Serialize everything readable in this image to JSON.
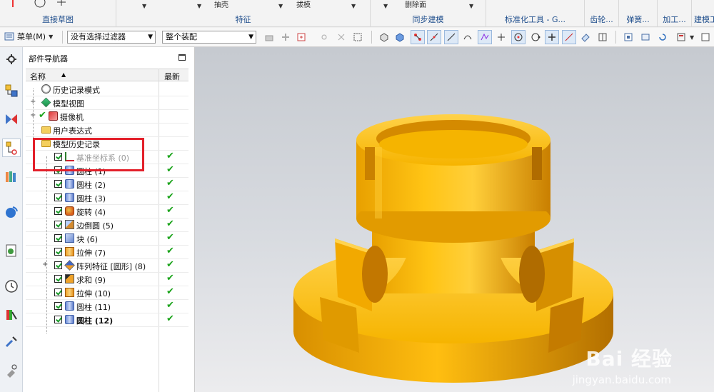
{
  "ribbon": {
    "groups": [
      {
        "label": "直接草图"
      },
      {
        "label": "特征"
      },
      {
        "label": "同步建模"
      },
      {
        "label": "标准化工具 - G..."
      },
      {
        "label": "齿轮..."
      },
      {
        "label": "弹簧..."
      },
      {
        "label": "加工..."
      },
      {
        "label": "建模工"
      }
    ],
    "partial_items": [
      "抽壳",
      "拔模",
      "删除面"
    ]
  },
  "toolbar": {
    "menu_label": "菜单(M)",
    "selection_filter": "没有选择过滤器",
    "assembly_scope": "整个装配"
  },
  "navigator": {
    "title": "部件导航器",
    "columns": {
      "name": "名称",
      "latest": "最新"
    },
    "rows": [
      {
        "label": "历史记录模式",
        "icon": "history-clock-icon",
        "level": 0,
        "checkbox": false,
        "latest": false,
        "expander": ""
      },
      {
        "label": "模型视图",
        "icon": "model-views-icon",
        "level": 0,
        "checkbox": false,
        "latest": false,
        "expander": "+"
      },
      {
        "label": "摄像机",
        "icon": "camera-icon",
        "level": 0,
        "checkbox": false,
        "latest": false,
        "expander": "+",
        "green_tick": true
      },
      {
        "label": "用户表达式",
        "icon": "folder-icon",
        "level": 0,
        "checkbox": false,
        "latest": false,
        "expander": ""
      },
      {
        "label": "模型历史记录",
        "icon": "folder-open-icon",
        "level": 0,
        "checkbox": false,
        "latest": false,
        "expander": "-"
      },
      {
        "label": "基准坐标系 (0)",
        "icon": "datum-csys-icon",
        "level": 1,
        "checkbox": true,
        "latest": true,
        "muted": true
      },
      {
        "label": "圆柱 (1)",
        "icon": "cylinder-icon",
        "level": 1,
        "checkbox": true,
        "latest": true
      },
      {
        "label": "圆柱 (2)",
        "icon": "cylinder-icon",
        "level": 1,
        "checkbox": true,
        "latest": true
      },
      {
        "label": "圆柱 (3)",
        "icon": "cylinder-icon",
        "level": 1,
        "checkbox": true,
        "latest": true
      },
      {
        "label": "旋转 (4)",
        "icon": "revolve-icon",
        "level": 1,
        "checkbox": true,
        "latest": true
      },
      {
        "label": "边倒圆 (5)",
        "icon": "edge-blend-icon",
        "level": 1,
        "checkbox": true,
        "latest": true
      },
      {
        "label": "块 (6)",
        "icon": "block-icon",
        "level": 1,
        "checkbox": true,
        "latest": true
      },
      {
        "label": "拉伸 (7)",
        "icon": "extrude-icon",
        "level": 1,
        "checkbox": true,
        "latest": true
      },
      {
        "label": "阵列特征 [圆形] (8)",
        "icon": "pattern-feature-icon",
        "level": 1,
        "checkbox": true,
        "latest": true,
        "expander": "+"
      },
      {
        "label": "求和 (9)",
        "icon": "unite-icon",
        "level": 1,
        "checkbox": true,
        "latest": true
      },
      {
        "label": "拉伸 (10)",
        "icon": "extrude-icon",
        "level": 1,
        "checkbox": true,
        "latest": true
      },
      {
        "label": "圆柱 (11)",
        "icon": "cylinder-icon",
        "level": 1,
        "checkbox": true,
        "latest": true
      },
      {
        "label": "圆柱 (12)",
        "icon": "cylinder-icon",
        "level": 1,
        "checkbox": true,
        "latest": true,
        "bold": true
      }
    ]
  },
  "watermark": {
    "main": "Bai 经验",
    "sub": "jingyan.baidu.com"
  },
  "colors": {
    "model": "#f5b400",
    "highlight": "#e3202a",
    "latest_tick": "#1aa31a"
  }
}
